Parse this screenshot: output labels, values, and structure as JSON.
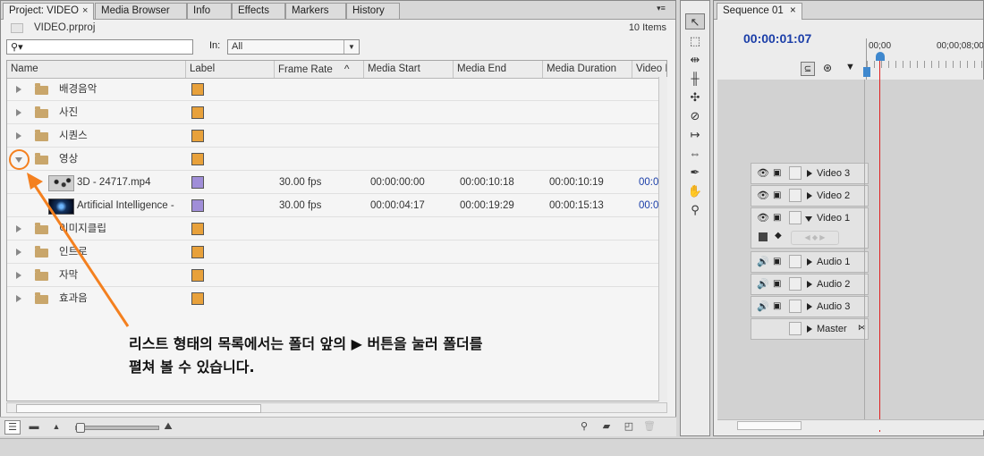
{
  "project_panel": {
    "tabs": [
      {
        "label": "Project: VIDEO",
        "close": "×"
      },
      {
        "label": "Media Browser"
      },
      {
        "label": "Info"
      },
      {
        "label": "Effects"
      },
      {
        "label": "Markers"
      },
      {
        "label": "History"
      }
    ],
    "menu_glyph": "▾≡",
    "project_file": "VIDEO.prproj",
    "item_count": "10 Items",
    "search": {
      "placeholder": "",
      "icon": "search-icon",
      "dropdown": "▾"
    },
    "in_label": "In:",
    "in_value": "All",
    "columns": [
      "Name",
      "Label",
      "Frame Rate",
      "Media Start",
      "Media End",
      "Media Duration",
      "Video I"
    ],
    "sort_glyph": "^",
    "rows": [
      {
        "type": "folder",
        "name": "배경음악",
        "label_color": "#e8a13b"
      },
      {
        "type": "folder",
        "name": "사진",
        "label_color": "#e8a13b"
      },
      {
        "type": "folder",
        "name": "시퀀스",
        "label_color": "#e8a13b"
      },
      {
        "type": "folder-open",
        "name": "영상",
        "label_color": "#e8a13b"
      },
      {
        "type": "clip",
        "name": "3D - 24717.mp4",
        "label_color": "#a08ed8",
        "frame_rate": "30.00 fps",
        "media_start": "00:00:00:00",
        "media_end": "00:00:10:18",
        "media_duration": "00:00:10:19",
        "video_info": "00:0"
      },
      {
        "type": "clip",
        "name": "Artificial Intelligence -",
        "label_color": "#a08ed8",
        "frame_rate": "30.00 fps",
        "media_start": "00:00:04:17",
        "media_end": "00:00:19:29",
        "media_duration": "00:00:15:13",
        "video_info": "00:0"
      },
      {
        "type": "folder",
        "name": "이미지클립",
        "label_color": "#e8a13b"
      },
      {
        "type": "folder",
        "name": "인트로",
        "label_color": "#e8a13b"
      },
      {
        "type": "folder",
        "name": "자막",
        "label_color": "#e8a13b"
      },
      {
        "type": "folder",
        "name": "효과음",
        "label_color": "#e8a13b"
      }
    ],
    "annotation_line1": "리스트 형태의 목록에서는 폴더 앞의 ▶ 버튼을 눌러 폴더를",
    "annotation_line2": "펼쳐 볼 수 있습니다.",
    "annotation_color": "#f4801f"
  },
  "tools": [
    "selection-tool",
    "track-select-tool",
    "ripple-edit-tool",
    "rolling-edit-tool",
    "rate-stretch-tool",
    "razor-tool",
    "slip-tool",
    "slide-tool",
    "pen-tool",
    "hand-tool",
    "zoom-tool"
  ],
  "sequence_panel": {
    "tab_label": "Sequence 01",
    "tab_close": "×",
    "timecode": "00:00:01:07",
    "ruler_labels": [
      "00;00",
      "00;00;08;00"
    ],
    "tracks": [
      {
        "label": "Video 3",
        "kind": "video"
      },
      {
        "label": "Video 2",
        "kind": "video"
      },
      {
        "label": "Video 1",
        "kind": "video",
        "expanded": true
      },
      {
        "label": "Audio 1",
        "kind": "audio"
      },
      {
        "label": "Audio 2",
        "kind": "audio"
      },
      {
        "label": "Audio 3",
        "kind": "audio"
      },
      {
        "label": "Master",
        "kind": "master"
      }
    ],
    "playhead_color": "#e02020"
  }
}
